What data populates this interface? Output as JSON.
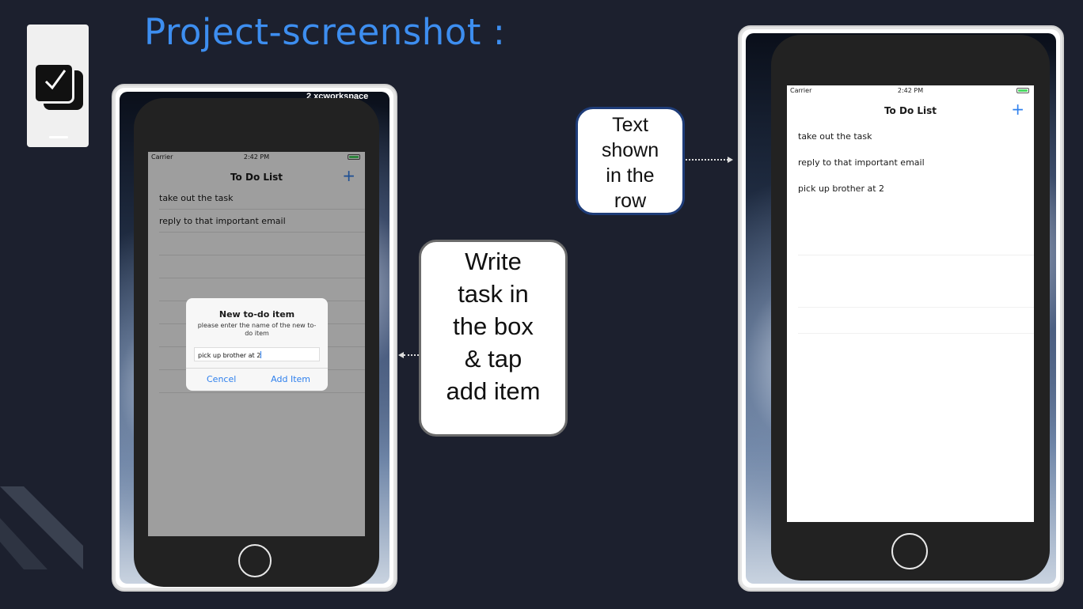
{
  "slide": {
    "title": "Project-screenshot :"
  },
  "app_icon": {
    "name": "checkbox-app-icon"
  },
  "left_phone": {
    "background_banner": "2 xcworkspace",
    "status": {
      "carrier": "Carrier",
      "time": "2:42 PM"
    },
    "nav": {
      "title": "To Do List",
      "add_icon": "+"
    },
    "rows": [
      "take out the task",
      "reply to that important email"
    ],
    "alert": {
      "title": "New to-do item",
      "message": "please enter the name of the new to-do item",
      "input_value": "pick up brother at 2",
      "cancel_label": "Cencel",
      "add_label": "Add Item"
    }
  },
  "right_phone": {
    "status": {
      "carrier": "Carrier",
      "time": "2:42 PM"
    },
    "nav": {
      "title": "To Do List",
      "add_icon": "+"
    },
    "rows": [
      "take out the task",
      "reply to that important email",
      "pick up brother at 2"
    ]
  },
  "callouts": {
    "left": [
      "Write",
      "task in",
      "the box",
      "& tap",
      "add item"
    ],
    "right": [
      "Text",
      "shown",
      "in the",
      "row"
    ]
  },
  "colors": {
    "accent": "#3d8ef0",
    "ios_blue": "#2f80ed",
    "background": "#1c202e"
  }
}
